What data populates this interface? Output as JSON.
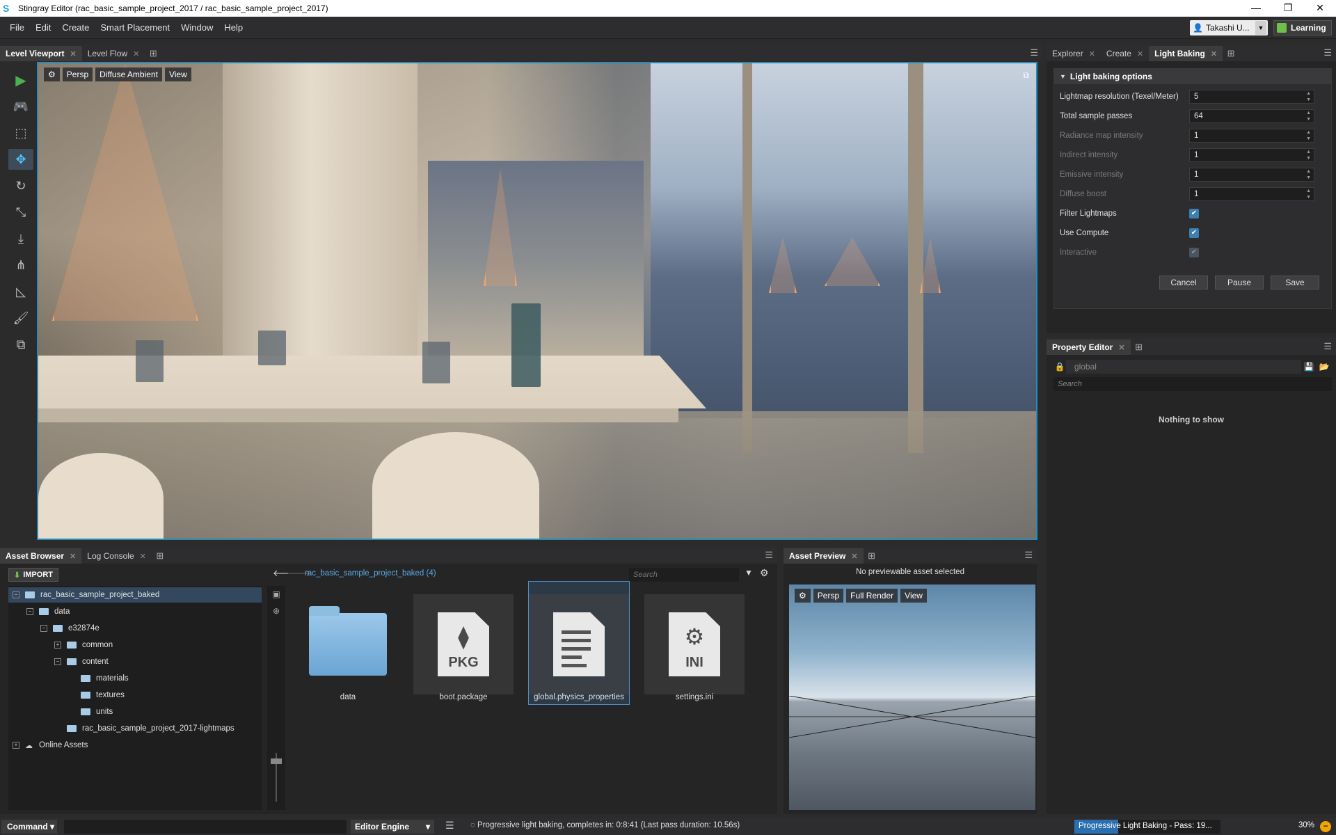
{
  "window": {
    "title": "Stingray Editor (rac_basic_sample_project_2017 / rac_basic_sample_project_2017)",
    "controls": [
      "—",
      "❐",
      "✕"
    ]
  },
  "menubar": {
    "items": [
      "File",
      "Edit",
      "Create",
      "Smart Placement",
      "Window",
      "Help"
    ],
    "user": "Takashi U...",
    "learning": "Learning"
  },
  "viewport_panel": {
    "tabs": [
      "Level Viewport",
      "Level Flow"
    ],
    "toolbar": {
      "camera": "Persp",
      "render_mode": "Diffuse Ambient",
      "view": "View"
    }
  },
  "right_panel": {
    "tabs": [
      "Explorer",
      "Create",
      "Light Baking"
    ],
    "section_title": "Light baking options",
    "fields": [
      {
        "label": "Lightmap resolution (Texel/Meter)",
        "value": "5",
        "enabled": true
      },
      {
        "label": "Total sample passes",
        "value": "64",
        "enabled": true
      },
      {
        "label": "Radiance map intensity",
        "value": "1",
        "enabled": false
      },
      {
        "label": "Indirect intensity",
        "value": "1",
        "enabled": false
      },
      {
        "label": "Emissive intensity",
        "value": "1",
        "enabled": false
      },
      {
        "label": "Diffuse boost",
        "value": "1",
        "enabled": false
      }
    ],
    "checkboxes": [
      {
        "label": "Filter Lightmaps",
        "checked": true,
        "enabled": true
      },
      {
        "label": "Use Compute",
        "checked": true,
        "enabled": true
      },
      {
        "label": "Interactive",
        "checked": true,
        "enabled": false
      }
    ],
    "buttons": {
      "cancel": "Cancel",
      "pause": "Pause",
      "save": "Save"
    }
  },
  "property_editor": {
    "tab": "Property Editor",
    "global_field": "global",
    "search_placeholder": "Search",
    "empty_message": "Nothing to show"
  },
  "asset_browser": {
    "tabs": [
      "Asset Browser",
      "Log Console"
    ],
    "import_label": "IMPORT",
    "breadcrumb": "rac_basic_sample_project_baked (4)",
    "search_placeholder": "Search",
    "tree": [
      {
        "label": "rac_basic_sample_project_baked",
        "toggle": "−",
        "type": "folder"
      },
      {
        "label": "data",
        "toggle": "−",
        "type": "folder"
      },
      {
        "label": "e32874e",
        "toggle": "−",
        "type": "folder"
      },
      {
        "label": "common",
        "toggle": "+",
        "type": "folder"
      },
      {
        "label": "content",
        "toggle": "−",
        "type": "folder"
      },
      {
        "label": "materials",
        "toggle": "",
        "type": "folder"
      },
      {
        "label": "textures",
        "toggle": "",
        "type": "folder"
      },
      {
        "label": "units",
        "toggle": "",
        "type": "folder"
      },
      {
        "label": "rac_basic_sample_project_2017-lightmaps",
        "toggle": "",
        "type": "folder"
      },
      {
        "label": "Online Assets",
        "toggle": "+",
        "type": "cloud"
      }
    ],
    "assets": [
      {
        "name": "data",
        "kind": "folder",
        "ext": ""
      },
      {
        "name": "boot.package",
        "kind": "package",
        "ext": "PKG"
      },
      {
        "name": "global.physics_properties",
        "kind": "document",
        "ext": ""
      },
      {
        "name": "settings.ini",
        "kind": "settings",
        "ext": "INI"
      }
    ]
  },
  "asset_preview": {
    "tab": "Asset Preview",
    "message": "No previewable asset selected",
    "toolbar": {
      "camera": "Persp",
      "render_mode": "Full Render",
      "view": "View"
    }
  },
  "statusbar": {
    "command": "Command",
    "engine": "Editor Engine",
    "status": "Progressive light baking, completes in: 0:8:41 (Last pass duration: 10.56s)",
    "progress_label": "Progressive Light Baking - Pass: 19...",
    "progress_fraction": 0.3,
    "percent": "30%"
  },
  "colors": {
    "accent": "#2a8bb8",
    "progress": "#2a6fb0",
    "play": "#4caf50",
    "light_gizmo": "#f3a36a"
  }
}
